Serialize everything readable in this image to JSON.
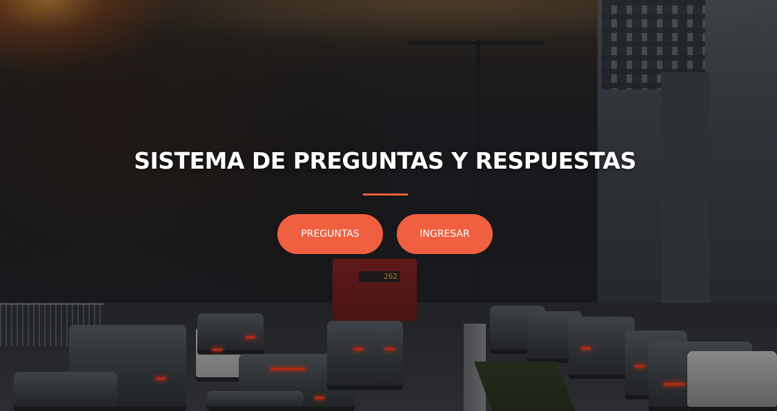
{
  "hero": {
    "title": "SISTEMA DE PREGUNTAS Y RESPUESTAS",
    "buttons": {
      "preguntas_label": "PREGUNTAS",
      "ingresar_label": "INGRESAR"
    },
    "bus_route": "262"
  },
  "colors": {
    "accent": "#f05f40",
    "divider": "#f4623a",
    "title_text": "#ffffff",
    "overlay": "rgba(15,15,18,0.35)"
  }
}
